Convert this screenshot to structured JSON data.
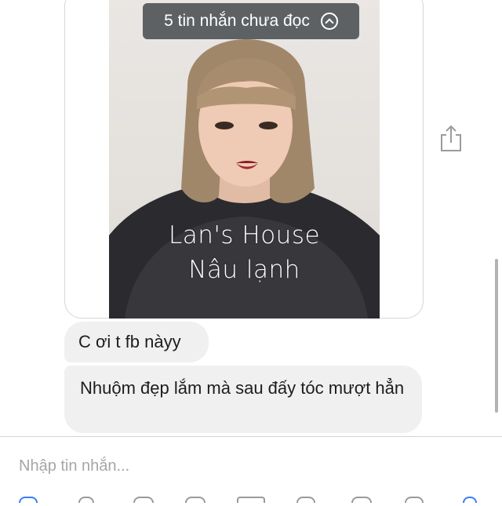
{
  "unread_banner": {
    "label": "5 tin nhắn chưa đọc",
    "icon": "chevron-up-circle-icon"
  },
  "attachment": {
    "caption_line1": "Lan's House",
    "caption_line2": "Nâu lạnh",
    "share_icon": "share-icon"
  },
  "messages": [
    {
      "text": "C ơi t fb nàyy"
    },
    {
      "text": "Nhuộm đẹp lắm mà sau đấy tóc mượt hẳn"
    }
  ],
  "composer": {
    "placeholder": "Nhập tin nhắn..."
  },
  "colors": {
    "bubble": "#f1f0f0",
    "pill": "#5e6163",
    "accent_blue": "#3a7ef7"
  }
}
